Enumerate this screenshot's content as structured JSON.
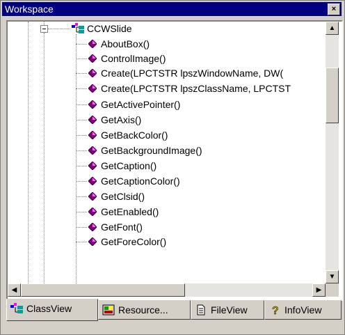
{
  "window": {
    "title": "Workspace",
    "close_label": "×"
  },
  "tree": {
    "root": {
      "label": "CCWSlide"
    },
    "methods": [
      "AboutBox()",
      "ControlImage()",
      "Create(LPCTSTR lpszWindowName, DW(",
      "Create(LPCTSTR lpszClassName, LPCTST",
      "GetActivePointer()",
      "GetAxis()",
      "GetBackColor()",
      "GetBackgroundImage()",
      "GetCaption()",
      "GetCaptionColor()",
      "GetClsid()",
      "GetEnabled()",
      "GetFont()",
      "GetForeColor()"
    ]
  },
  "scrollbars": {
    "up_arrow": "▲",
    "down_arrow": "▼",
    "left_arrow": "◀",
    "right_arrow": "▶"
  },
  "tabs": [
    {
      "label": "ClassView",
      "icon": "class-tree-icon"
    },
    {
      "label": "Resource...",
      "icon": "resource-icon"
    },
    {
      "label": "FileView",
      "icon": "file-icon"
    },
    {
      "label": "InfoView",
      "icon": "question-icon"
    }
  ],
  "colors": {
    "titlebar": "#000080",
    "face": "#d4d0c8",
    "method_icon": "#800080"
  }
}
